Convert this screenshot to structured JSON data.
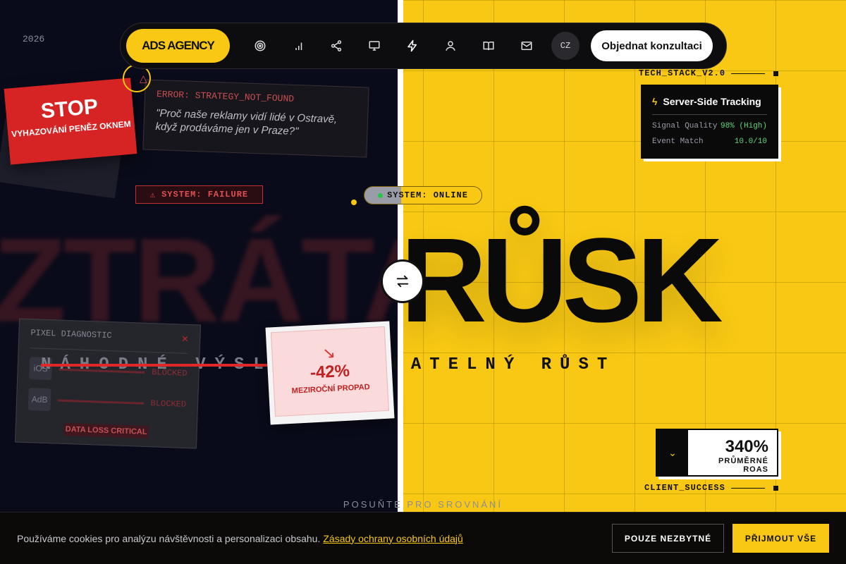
{
  "year": "2026",
  "nav": {
    "logo": "ADS AGENCY",
    "icons": [
      "target-icon",
      "chart-icon",
      "share-icon",
      "monitor-icon",
      "bolt-icon",
      "user-icon",
      "book-icon",
      "mail-icon"
    ],
    "lang": "CZ",
    "cta": "Objednat konzultaci"
  },
  "left": {
    "big_word": "ZTRÁTA",
    "stop_title": "STOP",
    "stop_sub": "VYHAZOVÁNÍ PENĚZ OKNEM",
    "error_code": "ERROR: STRATEGY_NOT_FOUND",
    "error_quote": "\"Proč naše reklamy vidí lidé v Ostravě, když prodáváme jen v Praze?\"",
    "system_status": "SYSTEM: FAILURE",
    "pixel_title": "PIXEL DIAGNOSTIC",
    "pixel_rows": [
      {
        "icon": "iOS",
        "status": "BLOCKED"
      },
      {
        "icon": "AdB",
        "status": "BLOCKED"
      }
    ],
    "pixel_alert": "DATA LOSS CRITICAL",
    "strike_text": "NÁHODNÉ VÝSLEDKY",
    "drop_value": "-42%",
    "drop_label": "MEZIROČNÍ PROPAD"
  },
  "right": {
    "big_word": "RŮSK",
    "system_status": "SYSTEM: ONLINE",
    "growth_text": "PŘEDVÍDATELNÝ RŮST",
    "tech_tag": "TECH_STACK_V2.0",
    "tech_title": "Server-Side Tracking",
    "tech_rows": [
      {
        "label": "Signal Quality",
        "value": "98% (High)"
      },
      {
        "label": "Event Match",
        "value": "10.0/10"
      }
    ],
    "roas_value": "340%",
    "roas_label": "PRŮMĚRNÉ ROAS",
    "client_tag": "CLIENT_SUCCESS"
  },
  "hint": "POSUŇTE PRO SROVNÁNÍ",
  "cookie": {
    "text": "Používáme cookies pro analýzu návštěvnosti a personalizaci obsahu.",
    "link": "Zásady ochrany osobních údajů",
    "btn_essential": "POUZE NEZBYTNÉ",
    "btn_accept": "PŘIJMOUT VŠE"
  },
  "colors": {
    "accent": "#f8c814",
    "danger": "#d62424",
    "dark": "#0a0b1a"
  }
}
